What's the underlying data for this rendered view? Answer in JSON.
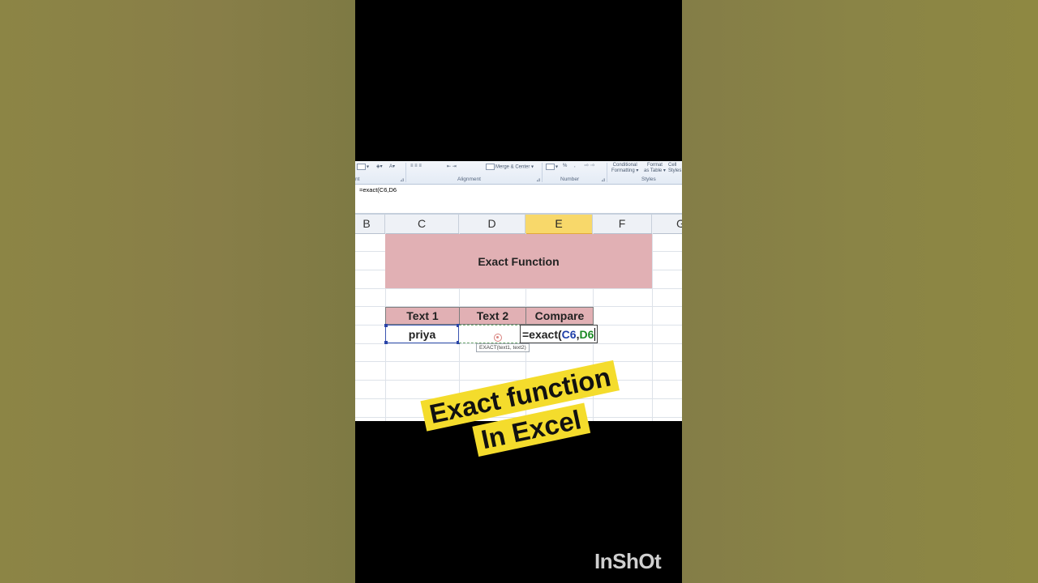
{
  "ribbon": {
    "merge_center": "Merge & Center",
    "percent": "%",
    "comma": ",",
    "conditional": "Conditional",
    "formatting": "Formatting",
    "format": "Format",
    "as_table": "as Table",
    "cell": "Cell",
    "styles_short": "Styles",
    "group_font_tail": "nt",
    "group_alignment": "Alignment",
    "group_number": "Number",
    "group_styles": "Styles"
  },
  "formula_bar": {
    "value": "=exact(C6,D6"
  },
  "columns": [
    "B",
    "C",
    "D",
    "E",
    "F",
    "G"
  ],
  "selected_column": "E",
  "sheet": {
    "title": "Exact Function",
    "headers": [
      "Text 1",
      "Text 2",
      "Compare"
    ],
    "c6_value": "priya",
    "formula_prefix": "=exact(",
    "formula_ref1": "C6",
    "formula_comma": ",",
    "formula_ref2": "D6",
    "tooltip": "EXACT(text1, text2)"
  },
  "overlay": {
    "line1": "Exact function",
    "line2": "In Excel",
    "watermark": "InShOt"
  },
  "colors": {
    "header_fill": "#e1b0b4",
    "selected_column": "#f8d86a",
    "banner": "#f4dc2c",
    "ref_c": "#1f3fa8",
    "ref_d": "#1b8a24"
  }
}
